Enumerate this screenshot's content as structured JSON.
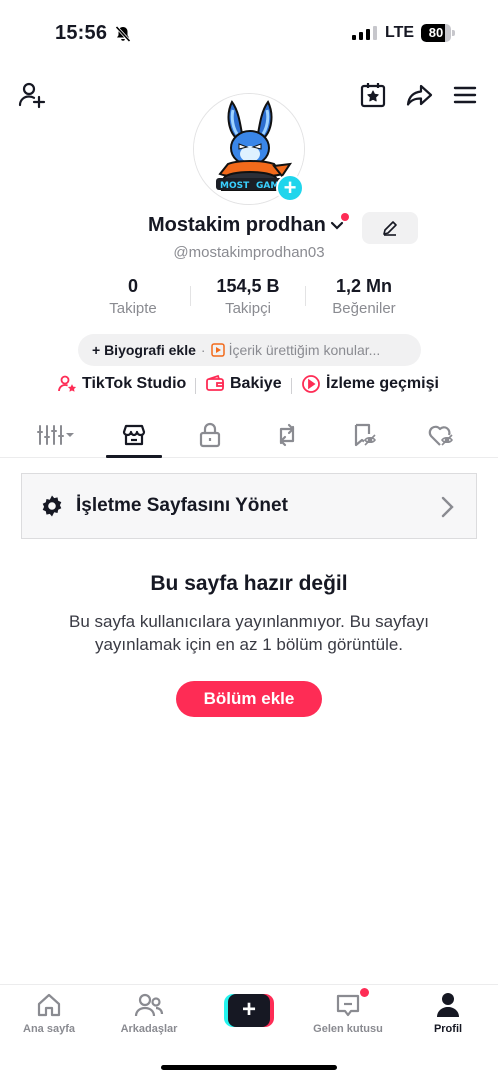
{
  "status_bar": {
    "time": "15:56",
    "network": "LTE",
    "battery": "80",
    "battery_level": 0.8
  },
  "header": {
    "icons": [
      "add-friend-icon",
      "calendar-star-icon",
      "share-icon",
      "menu-icon"
    ]
  },
  "profile": {
    "display_name": "Mostakim prodhan",
    "username": "@mostakimprodhan03",
    "stats": [
      {
        "value": "0",
        "label": "Takipte"
      },
      {
        "value": "154,5 B",
        "label": "Takipçi"
      },
      {
        "value": "1,2 Mn",
        "label": "Beğeniler"
      }
    ],
    "bio_add": "+ Biyografi ekle",
    "bio_topics": "İçerik ürettiğim konular..."
  },
  "links": [
    {
      "label": "TikTok Studio",
      "icon": "person-star-icon"
    },
    {
      "label": "Bakiye",
      "icon": "wallet-icon"
    },
    {
      "label": "İzleme geçmişi",
      "icon": "play-circle-icon"
    }
  ],
  "tabs": [
    "grid-filter-icon",
    "shop-icon",
    "lock-icon",
    "repost-icon",
    "bookmark-hidden-icon",
    "liked-hidden-icon"
  ],
  "active_tab": "shop-icon",
  "shop": {
    "manage_label": "İşletme Sayfasını Yönet",
    "empty_title": "Bu sayfa hazır değil",
    "empty_desc": "Bu sayfa kullanıcılara yayınlanmıyor. Bu sayfayı yayınlamak için en az 1 bölüm görüntüle.",
    "add_section": "Bölüm ekle"
  },
  "bottom_nav": [
    {
      "label": "Ana sayfa",
      "icon": "home-icon"
    },
    {
      "label": "Arkadaşlar",
      "icon": "friends-icon"
    },
    {
      "label": "",
      "icon": "create-plus-icon"
    },
    {
      "label": "Gelen kutusu",
      "icon": "inbox-icon"
    },
    {
      "label": "Profil",
      "icon": "profile-icon"
    }
  ],
  "colors": {
    "accent": "#fe2c55",
    "cyan": "#20d5ec",
    "text": "#161823",
    "muted": "#8a8b91"
  }
}
